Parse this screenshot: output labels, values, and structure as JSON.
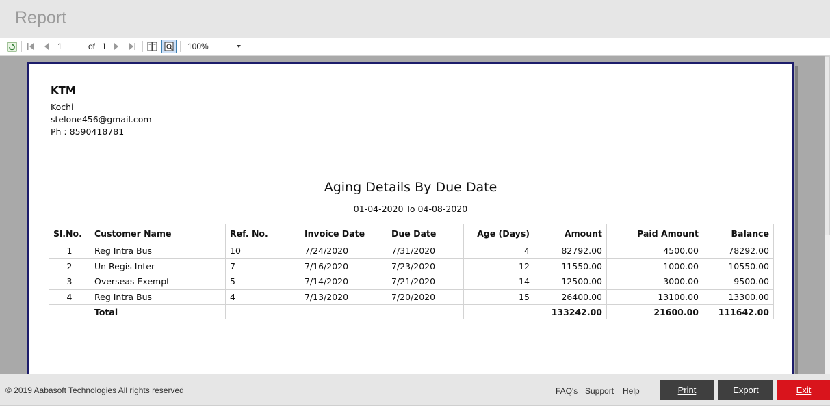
{
  "window": {
    "title": "Report"
  },
  "toolbar": {
    "page_value": "1",
    "of_label": "of",
    "total_pages": "1",
    "zoom_value": "100%"
  },
  "company": {
    "name": "KTM",
    "city": "Kochi",
    "email": "stelone456@gmail.com",
    "phone": "Ph : 8590418781"
  },
  "report": {
    "title": "Aging Details By Due Date",
    "date_range": "01-04-2020 To 04-08-2020",
    "columns": [
      "Sl.No.",
      "Customer Name",
      "Ref. No.",
      "Invoice Date",
      "Due Date",
      "Age (Days)",
      "Amount",
      "Paid Amount",
      "Balance"
    ],
    "rows": [
      {
        "sl": "1",
        "customer": "Reg Intra Bus",
        "ref": "10",
        "invoice_date": "7/24/2020",
        "due_date": "7/31/2020",
        "age": "4",
        "amount": "82792.00",
        "paid": "4500.00",
        "balance": "78292.00"
      },
      {
        "sl": "2",
        "customer": "Un Regis Inter",
        "ref": "7",
        "invoice_date": "7/16/2020",
        "due_date": "7/23/2020",
        "age": "12",
        "amount": "11550.00",
        "paid": "1000.00",
        "balance": "10550.00"
      },
      {
        "sl": "3",
        "customer": "Overseas Exempt",
        "ref": "5",
        "invoice_date": "7/14/2020",
        "due_date": "7/21/2020",
        "age": "14",
        "amount": "12500.00",
        "paid": "3000.00",
        "balance": "9500.00"
      },
      {
        "sl": "4",
        "customer": "Reg Intra Bus",
        "ref": "4",
        "invoice_date": "7/13/2020",
        "due_date": "7/20/2020",
        "age": "15",
        "amount": "26400.00",
        "paid": "13100.00",
        "balance": "13300.00"
      }
    ],
    "total": {
      "label": "Total",
      "amount": "133242.00",
      "paid": "21600.00",
      "balance": "111642.00"
    }
  },
  "footer": {
    "copyright": "© 2019 Aabasoft Technologies All rights reserved",
    "links": [
      "FAQ's",
      "Support",
      "Help"
    ],
    "buttons": {
      "print": "Print",
      "export": "Export",
      "exit": "Exit"
    }
  },
  "colors": {
    "accent_red": "#d9141c",
    "button_dark": "#3f3f3f",
    "page_border": "#1c1c6b"
  }
}
